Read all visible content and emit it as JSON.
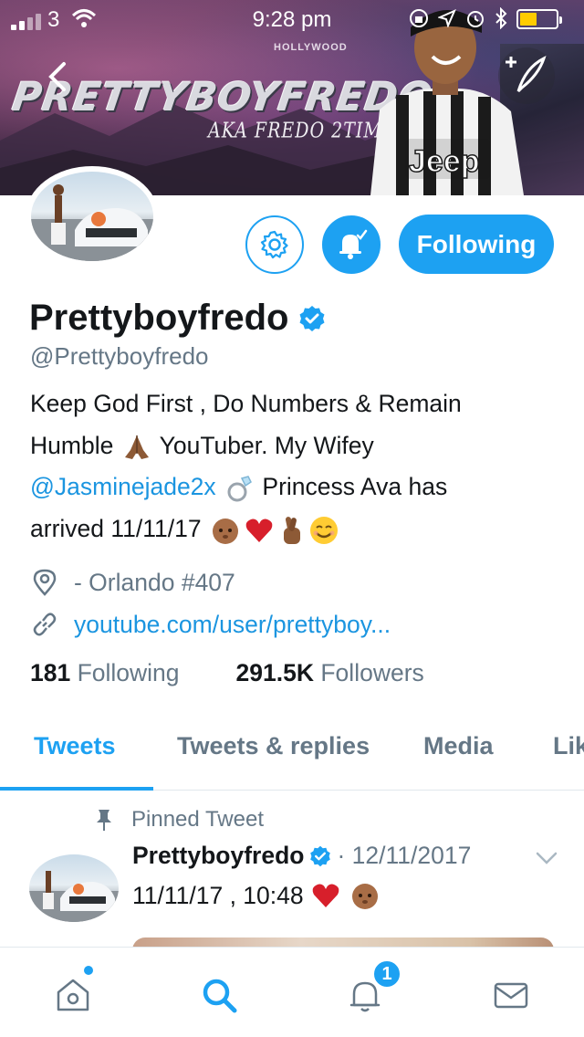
{
  "status_bar": {
    "carrier": "3",
    "time": "9:28 pm"
  },
  "header": {
    "banner_logo": "PRETTYBOYFREDO",
    "banner_subtitle": "AKA FREDO 2TIMES",
    "banner_sign": "HOLLYWOOD",
    "jersey_text": "Jeep"
  },
  "actions": {
    "follow_label": "Following"
  },
  "profile": {
    "display_name": "Prettyboyfredo",
    "handle": "@Prettyboyfredo",
    "bio_line1": "Keep God First , Do Numbers & Remain",
    "bio_line2_a": "Humble",
    "bio_line2_b": "YouTuber. My Wifey",
    "bio_mention": "@Jasminejade2x",
    "bio_line3_b": "Princess Ava has",
    "bio_line4": "arrived 11/11/17",
    "location": "- Orlando #407",
    "website": "youtube.com/user/prettyboy...",
    "following_count": "181",
    "following_label": "Following",
    "followers_count": "291.5K",
    "followers_label": "Followers"
  },
  "tabs": [
    {
      "label": "Tweets"
    },
    {
      "label": "Tweets & replies"
    },
    {
      "label": "Media"
    },
    {
      "label": "Lik"
    }
  ],
  "pinned_tweet": {
    "label": "Pinned Tweet",
    "author": "Prettyboyfredo",
    "date": "· 12/11/2017",
    "text": "11/11/17 , 10:48"
  },
  "bottom_nav": {
    "notification_badge": "1"
  },
  "colors": {
    "accent": "#1da1f2",
    "link": "#1b95e0",
    "muted": "#657786",
    "text": "#14171a"
  }
}
